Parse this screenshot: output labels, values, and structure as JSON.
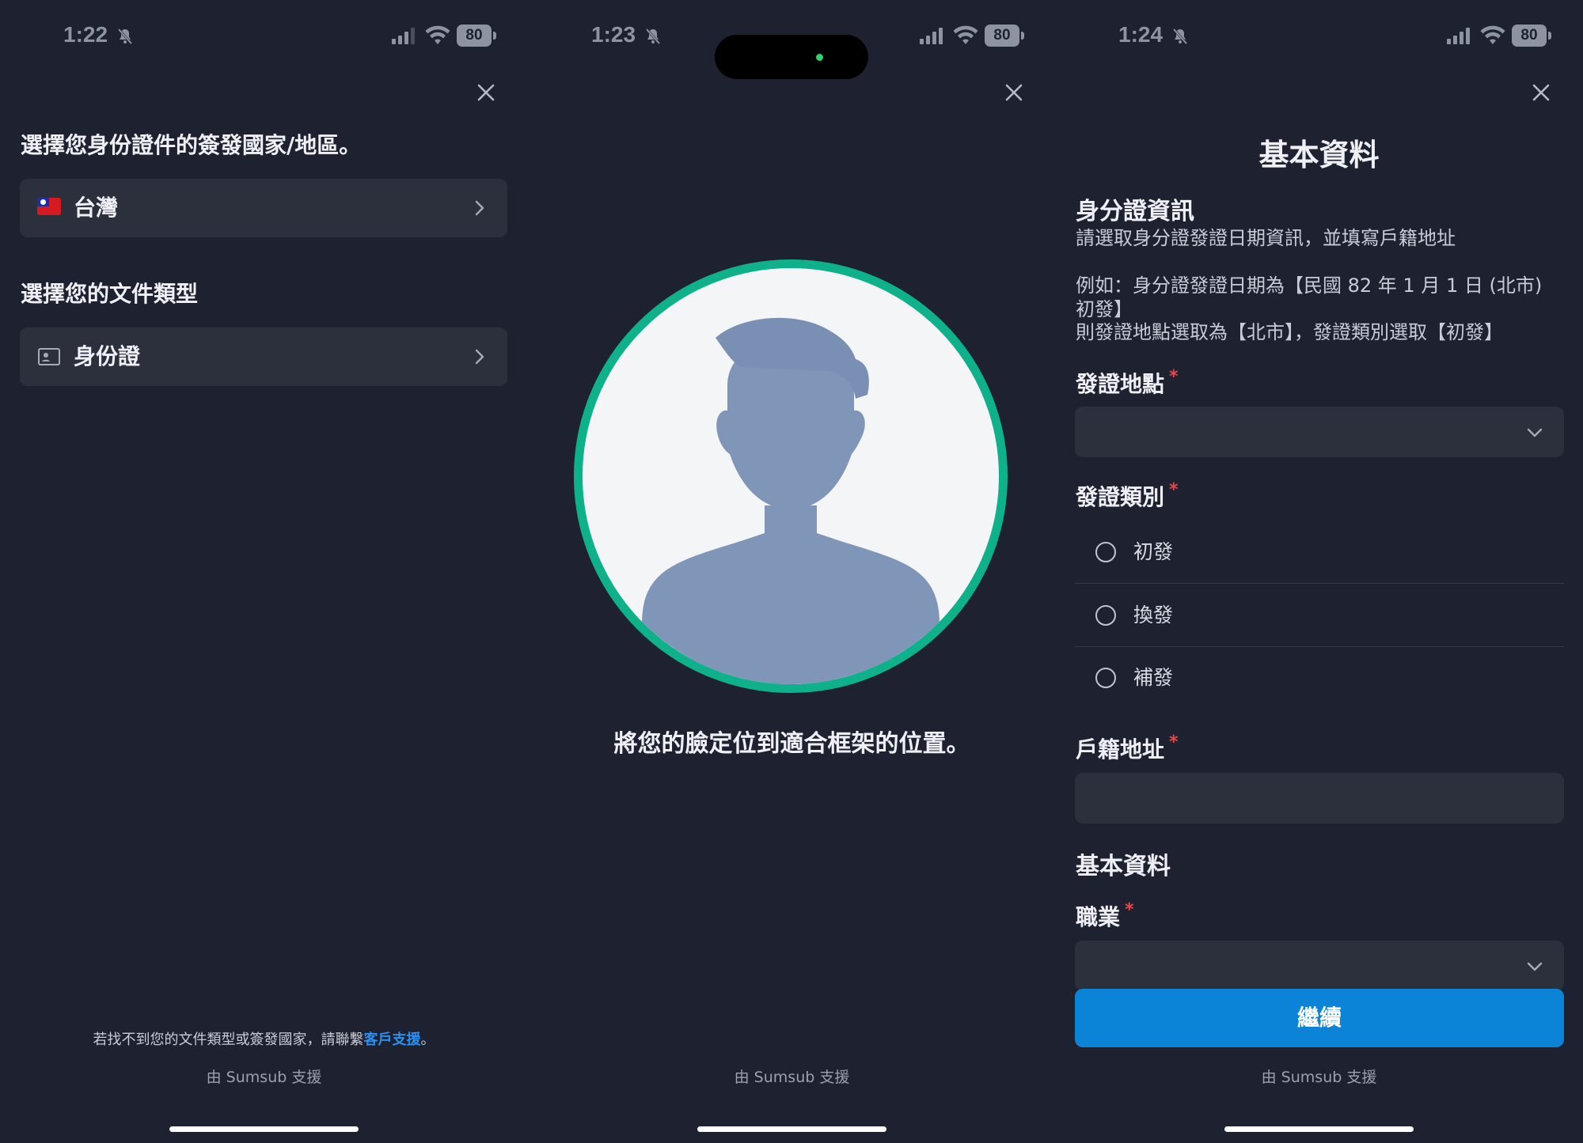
{
  "screens": [
    {
      "status": {
        "time": "1:22",
        "battery": "80"
      },
      "title": "選擇您身份證件的簽發國家/地區。",
      "country": {
        "label": "台灣",
        "flag_icon": "taiwan-flag-icon"
      },
      "doc_heading": "選擇您的文件類型",
      "doc": {
        "label": "身份證",
        "icon": "id-card-icon"
      },
      "help_prefix": "若找不到您的文件類型或簽發國家，請聯繫",
      "help_link": "客戶支援",
      "help_suffix": "。",
      "powered": "由 Sumsub 支援"
    },
    {
      "status": {
        "time": "1:23",
        "battery": "80"
      },
      "caption": "將您的臉定位到適合框架的位置。",
      "powered": "由 Sumsub 支援"
    },
    {
      "status": {
        "time": "1:24",
        "battery": "80"
      },
      "title": "基本資料",
      "id_section": "身分證資訊",
      "id_desc1": "請選取身分證發證日期資訊，並填寫戶籍地址",
      "id_desc2": "例如：身分證發證日期為【民國 82 年 1 月 1 日 (北市) 初發】",
      "id_desc3": "則發證地點選取為【北市】，發證類別選取【初發】",
      "issue_place_label": "發證地點",
      "issue_place_value": "",
      "issue_type_label": "發證類別",
      "issue_type_options": [
        "初發",
        "換發",
        "補發"
      ],
      "address_label": "戶籍地址",
      "address_value": "",
      "basic_section": "基本資料",
      "job_label": "職業",
      "job_value": "",
      "required_mark": "*",
      "continue": "繼續",
      "powered": "由 Sumsub 支援"
    }
  ],
  "colors": {
    "background": "#1e2230",
    "field": "#2c303d",
    "accent": "#0b84d8",
    "ring": "#0fb18a",
    "required": "#e5484d",
    "link": "#2b8ff0"
  }
}
